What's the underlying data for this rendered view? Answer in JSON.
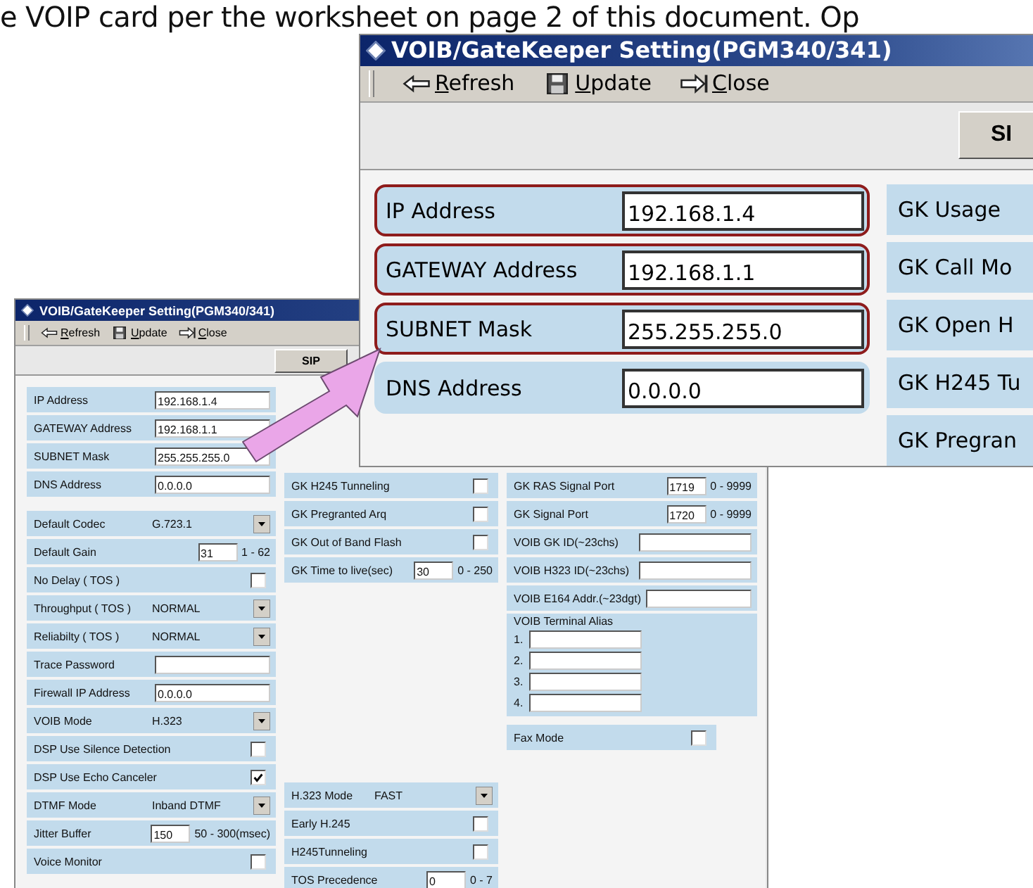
{
  "intro_text": "e VOIP card per the worksheet on page 2 of this document. Op",
  "small_window": {
    "title": "VOIB/GateKeeper Setting(PGM340/341)",
    "toolbar": [
      {
        "kind": "refresh",
        "label": "Refresh"
      },
      {
        "kind": "update",
        "label": "Update"
      },
      {
        "kind": "close",
        "label": "Close"
      }
    ],
    "tab": "SIP",
    "columns": [
      {
        "sections": [
          {
            "rows": [
              {
                "kind": "input",
                "label": "IP Address",
                "value": "192.168.1.4"
              },
              {
                "kind": "input",
                "label": "GATEWAY Address",
                "value": "192.168.1.1"
              },
              {
                "kind": "input",
                "label": "SUBNET Mask",
                "value": "255.255.255.0"
              },
              {
                "kind": "input",
                "label": "DNS Address",
                "value": "0.0.0.0"
              }
            ]
          },
          {
            "rows": [
              {
                "kind": "select",
                "label": "Default Codec",
                "value": "G.723.1"
              },
              {
                "kind": "range",
                "label": "Default Gain",
                "value": "31",
                "range": "1 - 62"
              },
              {
                "kind": "checkbox",
                "label": "No Delay ( TOS )",
                "checked": false
              },
              {
                "kind": "select",
                "label": "Throughput ( TOS )",
                "value": "NORMAL"
              },
              {
                "kind": "select",
                "label": "Reliabilty ( TOS )",
                "value": "NORMAL"
              },
              {
                "kind": "input",
                "label": "Trace Password"
              },
              {
                "kind": "input",
                "label": "Firewall IP Address",
                "value": "0.0.0.0"
              },
              {
                "kind": "select",
                "label": "VOIB Mode",
                "value": "H.323"
              },
              {
                "kind": "checkbox",
                "label": "DSP Use Silence Detection",
                "checked": false
              },
              {
                "kind": "checkbox",
                "label": "DSP Use Echo Canceler",
                "checked": true
              },
              {
                "kind": "select",
                "label": "DTMF Mode",
                "value": "Inband DTMF"
              },
              {
                "kind": "range",
                "label": "Jitter Buffer",
                "value": "150",
                "range": "50 - 300(msec)"
              },
              {
                "kind": "checkbox",
                "label": "Voice Monitor",
                "checked": false
              }
            ]
          }
        ]
      },
      {
        "sections": [
          {
            "rows": [
              {
                "kind": "checkbox",
                "label": "GK H245 Tunneling",
                "checked": false
              },
              {
                "kind": "checkbox",
                "label": "GK Pregranted Arq",
                "checked": false
              },
              {
                "kind": "checkbox",
                "label": "GK Out of Band Flash",
                "checked": false
              },
              {
                "kind": "range",
                "label": "GK Time to live(sec)",
                "value": "30",
                "range": "0 - 250"
              }
            ]
          },
          {
            "rows": [
              {
                "kind": "select",
                "label": "H.323 Mode",
                "value": "FAST"
              },
              {
                "kind": "checkbox",
                "label": "Early H.245",
                "checked": false
              },
              {
                "kind": "checkbox",
                "label": "H245Tunneling",
                "checked": false
              },
              {
                "kind": "range",
                "label": "TOS Precedence",
                "value": "0",
                "range": "0 - 7"
              }
            ]
          }
        ]
      },
      {
        "sections": [
          {
            "rows": [
              {
                "kind": "range",
                "label": "GK RAS Signal Port",
                "value": "1719",
                "range": "0 - 9999"
              },
              {
                "kind": "range",
                "label": "GK Signal Port",
                "value": "1720",
                "range": "0 - 9999"
              },
              {
                "kind": "input",
                "label": "VOIB GK ID(~23chs)"
              },
              {
                "kind": "input",
                "label": "VOIB H323 ID(~23chs)"
              },
              {
                "kind": "input",
                "label": "VOIB E164 Addr.(~23dgt)"
              },
              {
                "kind": "alias",
                "label": "VOIB Terminal Alias",
                "slots": [
                  "1.",
                  "2.",
                  "3.",
                  "4."
                ]
              },
              {
                "kind": "checkbox",
                "label": "Fax Mode",
                "checked": false
              }
            ]
          }
        ]
      }
    ]
  },
  "large_window": {
    "title": "VOIB/GateKeeper Setting(PGM340/341)",
    "toolbar": [
      {
        "kind": "refresh",
        "label": "Refresh"
      },
      {
        "kind": "update",
        "label": "Update"
      },
      {
        "kind": "close",
        "label": "Close"
      }
    ],
    "tab": "SI",
    "rows": [
      {
        "label": "IP Address",
        "value": "192.168.1.4",
        "highlighted": true
      },
      {
        "label": "GATEWAY Address",
        "value": "192.168.1.1",
        "highlighted": true
      },
      {
        "label": "SUBNET Mask",
        "value": "255.255.255.0",
        "highlighted": true
      },
      {
        "label": "DNS Address",
        "value": "0.0.0.0",
        "highlighted": false
      }
    ],
    "side_rows": [
      "GK Usage",
      "GK Call Mo",
      "GK Open H",
      "GK H245 Tu",
      "GK Pregran"
    ]
  }
}
